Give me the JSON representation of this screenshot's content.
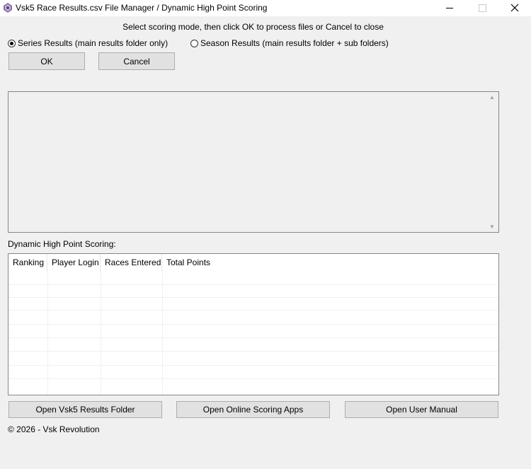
{
  "window": {
    "title": "Vsk5 Race Results.csv File Manager / Dynamic High Point Scoring",
    "icon": "app-icon",
    "controls": {
      "minimize": "minimize",
      "maximize": "maximize",
      "close": "close"
    }
  },
  "instructions": "Select scoring mode, then click OK to process files or Cancel to close",
  "modes": {
    "series": {
      "label": "Series Results (main results folder only)",
      "checked": true
    },
    "season": {
      "label": "Season Results (main results folder + sub folders)",
      "checked": false
    }
  },
  "buttons": {
    "ok": "OK",
    "cancel": "Cancel",
    "open_results_folder": "Open Vsk5 Results Folder",
    "open_online_apps": "Open Online Scoring Apps",
    "open_manual": "Open User Manual"
  },
  "output_text": "",
  "scoring": {
    "section_label": "Dynamic High Point Scoring:",
    "columns": [
      "Ranking",
      "Player Login",
      "Races Entered",
      "Total Points"
    ],
    "rows": []
  },
  "footer": {
    "copyright": "© 2026 - Vsk Revolution"
  },
  "colors": {
    "background": "#f0f0f0",
    "button_face": "#e1e1e1",
    "border": "#adadad"
  }
}
